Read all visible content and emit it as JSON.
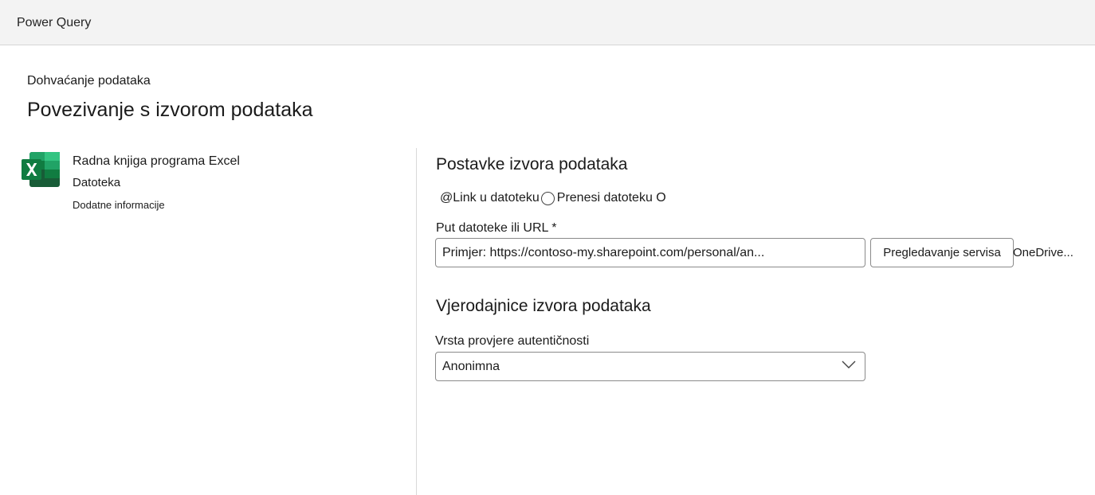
{
  "app": {
    "title": "Power Query"
  },
  "header": {
    "breadcrumb": "Dohvaćanje podataka",
    "title": "Povezivanje s izvorom podataka"
  },
  "connector": {
    "icon": "excel-icon",
    "name": "Radna knjiga programa Excel",
    "category": "Datoteka",
    "more_info_link": "Dodatne informacije"
  },
  "settings": {
    "section_title": "Postavke izvora podataka",
    "radio_link_label": "@Link u datoteku",
    "radio_upload_label": "Prenesi datoteku O",
    "path_label": "Put datoteke ili URL *",
    "path_placeholder": "Primjer: https://contoso-my.sharepoint.com/personal/an...",
    "browse_button": "Pregledavanje servisa",
    "browse_button_overflow": "OneDrive..."
  },
  "credentials": {
    "section_title": "Vjerodajnice izvora podataka",
    "auth_label": "Vrsta provjere autentičnosti",
    "auth_value": "Anonimna"
  },
  "colors": {
    "topbar_bg": "#f3f3f3",
    "excel_green_dark": "#185c37",
    "excel_green": "#21a366",
    "excel_green_light": "#33c481",
    "excel_green_mid": "#107c41"
  }
}
